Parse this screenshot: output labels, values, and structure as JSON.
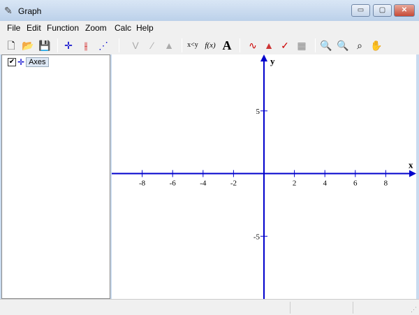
{
  "window": {
    "title": "Graph",
    "minimize": "▭",
    "maximize": "▢",
    "close": "✕"
  },
  "menu": [
    "File",
    "Edit",
    "Function",
    "Zoom",
    "Calc",
    "Help"
  ],
  "toolbar": {
    "xy_label": "x<y",
    "fx_label": "f(x)",
    "text_label": "A"
  },
  "sidebar": {
    "items": [
      {
        "label": "Axes",
        "checked": true,
        "check": "✔"
      }
    ]
  },
  "graph": {
    "x_label": "x",
    "y_label": "y",
    "xlim": [
      -10,
      10
    ],
    "ylim": [
      -10,
      9.5
    ],
    "x_ticks": [
      "-8",
      "-6",
      "-4",
      "-2",
      "2",
      "4",
      "6",
      "8"
    ],
    "y_ticks": [
      "5",
      "-5"
    ],
    "axis_color": "#0000cc"
  }
}
